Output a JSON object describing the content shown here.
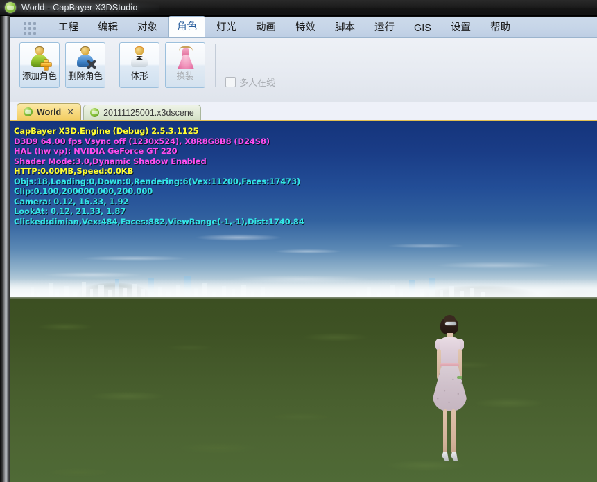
{
  "window": {
    "title": "World - CapBayer X3DStudio",
    "app_icon": "sphere-icon"
  },
  "menubar": {
    "grid_icon": "grid-dots-icon",
    "items": [
      {
        "label": "工程",
        "active": false
      },
      {
        "label": "编辑",
        "active": false
      },
      {
        "label": "对象",
        "active": false
      },
      {
        "label": "角色",
        "active": true
      },
      {
        "label": "灯光",
        "active": false
      },
      {
        "label": "动画",
        "active": false
      },
      {
        "label": "特效",
        "active": false
      },
      {
        "label": "脚本",
        "active": false
      },
      {
        "label": "运行",
        "active": false
      },
      {
        "label": "GIS",
        "active": false
      },
      {
        "label": "设置",
        "active": false
      },
      {
        "label": "帮助",
        "active": false
      }
    ]
  },
  "ribbon": {
    "buttons": [
      {
        "label": "添加角色",
        "icon": "person-add-icon",
        "disabled": false
      },
      {
        "label": "删除角色",
        "icon": "person-delete-icon",
        "disabled": false
      },
      {
        "label": "体形",
        "icon": "person-body-icon",
        "disabled": false
      },
      {
        "label": "换装",
        "icon": "dress-icon",
        "disabled": true
      }
    ],
    "checkbox": {
      "label": "多人在线",
      "checked": false,
      "disabled": true
    }
  },
  "doc_tabs": [
    {
      "label": "World",
      "active": true,
      "closable": true,
      "close_glyph": "✕",
      "icon": "scene-icon"
    },
    {
      "label": "20111125001.x3dscene",
      "active": false,
      "closable": false,
      "icon": "scene-icon"
    }
  ],
  "viewport": {
    "debug_lines": [
      {
        "text": "CapBayer X3D.Engine (Debug) 2.5.3.1125",
        "color": "#ffff33"
      },
      {
        "text": "D3D9 64.00 fps Vsync off (1230x524), X8R8G8B8 (D24S8)",
        "color": "#ff4df0"
      },
      {
        "text": "HAL (hw vp): NVIDIA GeForce GT 220",
        "color": "#ff4df0"
      },
      {
        "text": "Shader Mode:3.0,Dynamic Shadow Enabled",
        "color": "#ff4df0"
      },
      {
        "text": "HTTP:0.00MB,Speed:0.0KB",
        "color": "#ffff33"
      },
      {
        "text": "Objs:18,Loading:0,Down:0,Rendering:6(Vex:11200,Faces:17473)",
        "color": "#33e6e6"
      },
      {
        "text": "Clip:0.100,200000.000,200.000",
        "color": "#33e6e6"
      },
      {
        "text": "Camera: 0.12, 16.33, 1.92",
        "color": "#33e6e6"
      },
      {
        "text": "LookAt: 0.12, 21.33, 1.87",
        "color": "#33e6e6"
      },
      {
        "text": "Clicked:dimian,Vex:484,Faces:882,ViewRange(-1,-1),Dist:1740.84",
        "color": "#33e6e6"
      }
    ],
    "scene": {
      "character": "female-avatar",
      "ground": "grass-terrain",
      "sky": "blue-sky-with-city-skyline"
    }
  },
  "colors": {
    "titlebar": "#151515",
    "ribbon_menu": "#c6d5e8",
    "ribbon_body": "#e6eaf1",
    "active_menu_text": "#2a5f9e",
    "active_tab": "#f7d97e",
    "inactive_tab": "#dfe9d4",
    "viewport_sky": "#15347c",
    "viewport_ground": "#44592a"
  }
}
